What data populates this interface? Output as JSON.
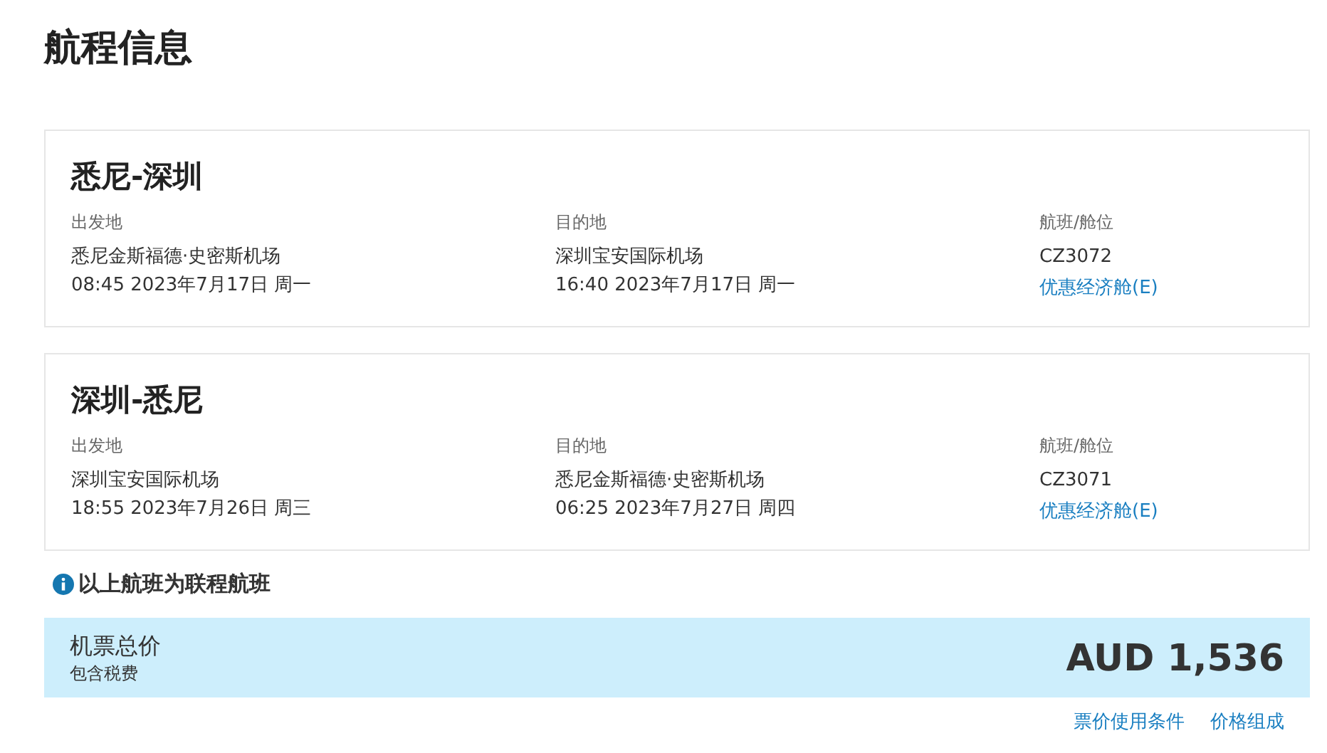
{
  "page_title": "航程信息",
  "segments": [
    {
      "route": "悉尼-深圳",
      "origin_label": "出发地",
      "origin_airport": "悉尼金斯福德·史密斯机场",
      "origin_time": "08:45 2023年7月17日 周一",
      "dest_label": "目的地",
      "dest_airport": "深圳宝安国际机场",
      "dest_time": "16:40 2023年7月17日 周一",
      "flight_label": "航班/舱位",
      "flight_no": "CZ3072",
      "cabin": "优惠经济舱(E)"
    },
    {
      "route": "深圳-悉尼",
      "origin_label": "出发地",
      "origin_airport": "深圳宝安国际机场",
      "origin_time": "18:55 2023年7月26日 周三",
      "dest_label": "目的地",
      "dest_airport": "悉尼金斯福德·史密斯机场",
      "dest_time": "06:25 2023年7月27日 周四",
      "flight_label": "航班/舱位",
      "flight_no": "CZ3071",
      "cabin": "优惠经济舱(E)"
    }
  ],
  "notice": "以上航班为联程航班",
  "total": {
    "label": "机票总价",
    "sublabel": "包含税费",
    "price": "AUD 1,536"
  },
  "links": [
    "票价使用条件",
    "价格组成"
  ]
}
